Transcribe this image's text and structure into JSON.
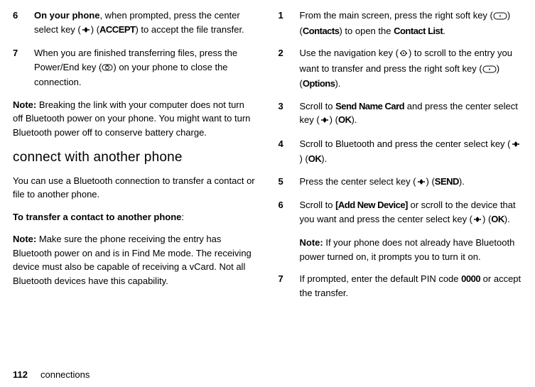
{
  "left": {
    "step6": {
      "num": "6",
      "lead_bold": "On your phone",
      "t1": ", when prompted, press the center select key (",
      "icon": "center-select-icon",
      "t2": ") (",
      "label": "ACCEPT",
      "t3": ") to accept the file transfer."
    },
    "step7": {
      "num": "7",
      "t1": "When you are finished transferring files, press the Power/End key (",
      "icon": "end-key-icon",
      "t2": ") on your phone to close the connection."
    },
    "note": {
      "lead": "Note:",
      "text": " Breaking the link with your computer does not turn off Bluetooth power on your phone. You might want to turn Bluetooth power off to conserve battery charge."
    },
    "heading": "connect with another phone",
    "intro": "You can use a Bluetooth connection to transfer a contact or file to another phone.",
    "transfer": {
      "lead": "To transfer a contact to another phone",
      "tail": ":"
    },
    "note2": {
      "lead": "Note:",
      "text": " Make sure the phone receiving the entry has Bluetooth power on and is in Find Me mode. The receiving device must also be capable of receiving a vCard. Not all Bluetooth devices have this capability."
    }
  },
  "right": {
    "step1": {
      "num": "1",
      "t1": "From the main screen, press the right soft key (",
      "icon": "soft-key-icon",
      "t2": ") (",
      "label": "Contacts",
      "t3": ") to open the ",
      "label2": "Contact List",
      "t4": "."
    },
    "step2": {
      "num": "2",
      "t1": "Use the navigation key (",
      "icon1": "nav-key-icon",
      "t2": ") to scroll to the entry you want to transfer and press the right soft key (",
      "icon2": "soft-key-icon",
      "t3": ") (",
      "label": "Options",
      "t4": ")."
    },
    "step3": {
      "num": "3",
      "t1": "Scroll to ",
      "label1": "Send Name Card",
      "t2": " and press the center select key (",
      "icon": "center-select-icon",
      "t3": ") (",
      "label2": "OK",
      "t4": ")."
    },
    "step4": {
      "num": "4",
      "t1": "Scroll to Bluetooth and press the center select key (",
      "icon": "center-select-icon",
      "t2": ") (",
      "label": "OK",
      "t3": ")."
    },
    "step5": {
      "num": "5",
      "t1": "Press the center select key (",
      "icon": "center-select-icon",
      "t2": ") (",
      "label": "SEND",
      "t3": ")."
    },
    "step6": {
      "num": "6",
      "t1": "Scroll to ",
      "label1": "[Add New Device]",
      "t2": " or scroll to the device that you want and press the center select key (",
      "icon": "center-select-icon",
      "t3": ") (",
      "label2": "OK",
      "t4": ")."
    },
    "note": {
      "lead": "Note:",
      "text": " If your phone does not already have Bluetooth power turned on, it prompts you to turn it on."
    },
    "step7": {
      "num": "7",
      "t1": "If prompted, enter the default PIN code ",
      "code": "0000",
      "t2": " or accept the transfer."
    }
  },
  "footer": {
    "page": "112",
    "section": "connections"
  }
}
